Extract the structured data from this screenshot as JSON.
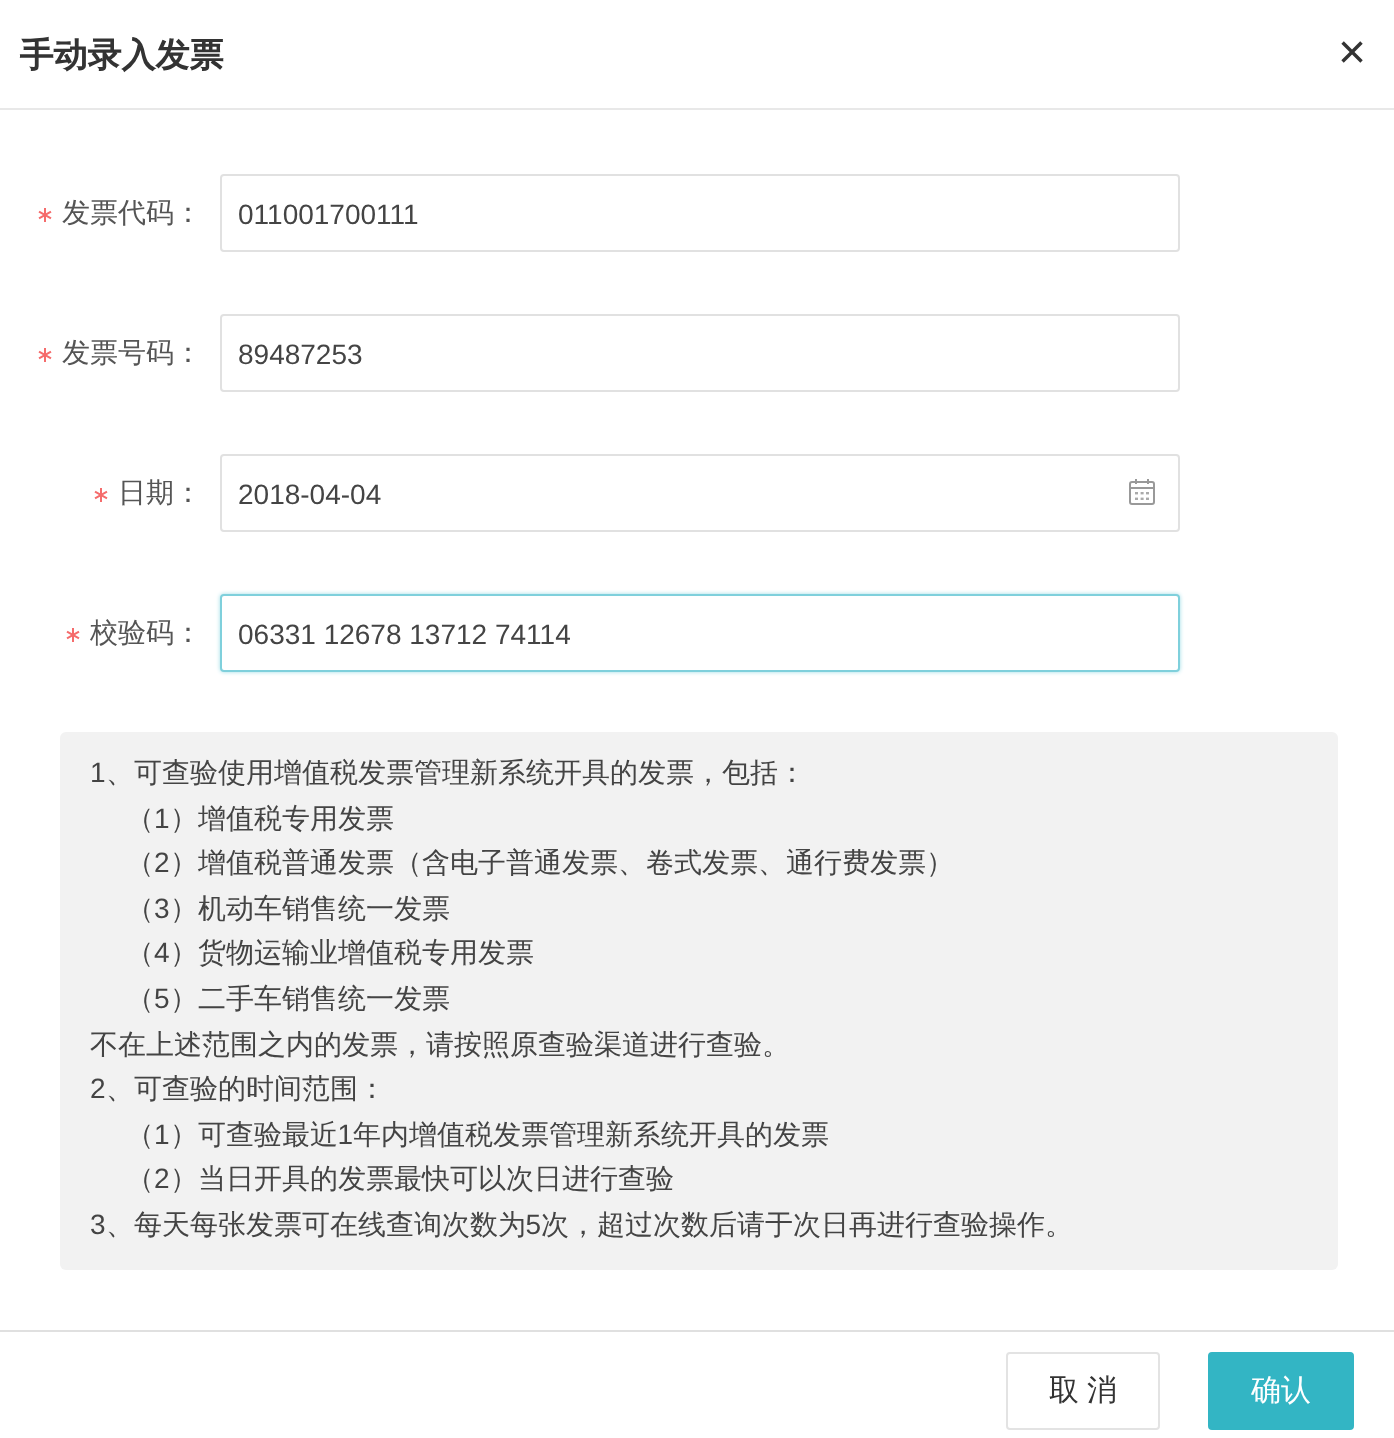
{
  "dialog": {
    "title": "手动录入发票",
    "close": "×"
  },
  "fields": [
    {
      "label": "发票代码：",
      "required": true,
      "kind": "text",
      "value": "011001700111",
      "focused": false
    },
    {
      "label": "发票号码：",
      "required": true,
      "kind": "text",
      "value": "89487253",
      "focused": false
    },
    {
      "label": "日期：",
      "required": true,
      "kind": "date",
      "value": "2018-04-04",
      "focused": false
    },
    {
      "label": "校验码：",
      "required": true,
      "kind": "text",
      "value": "06331 12678 13712 74114",
      "focused": true
    }
  ],
  "info": [
    {
      "kind": "main",
      "text": "1、可查验使用增值税发票管理新系统开具的发票，包括："
    },
    {
      "kind": "sub",
      "text": "（1）增值税专用发票"
    },
    {
      "kind": "sub",
      "text": "（2）增值税普通发票（含电子普通发票、卷式发票、通行费发票）"
    },
    {
      "kind": "sub",
      "text": "（3）机动车销售统一发票"
    },
    {
      "kind": "sub",
      "text": "（4）货物运输业增值税专用发票"
    },
    {
      "kind": "sub",
      "text": "（5）二手车销售统一发票"
    },
    {
      "kind": "main",
      "text": "不在上述范围之内的发票，请按照原查验渠道进行查验。"
    },
    {
      "kind": "main",
      "text": "2、可查验的时间范围："
    },
    {
      "kind": "sub",
      "text": "（1）可查验最近1年内增值税发票管理新系统开具的发票"
    },
    {
      "kind": "sub",
      "text": "（2）当日开具的发票最快可以次日进行查验"
    },
    {
      "kind": "main",
      "text": "3、每天每张发票可在线查询次数为5次，超过次数后请于次日再进行查验操作。"
    }
  ],
  "buttons": [
    {
      "label": "取 消",
      "kind": "secondary"
    },
    {
      "label": "确认",
      "kind": "primary"
    }
  ]
}
